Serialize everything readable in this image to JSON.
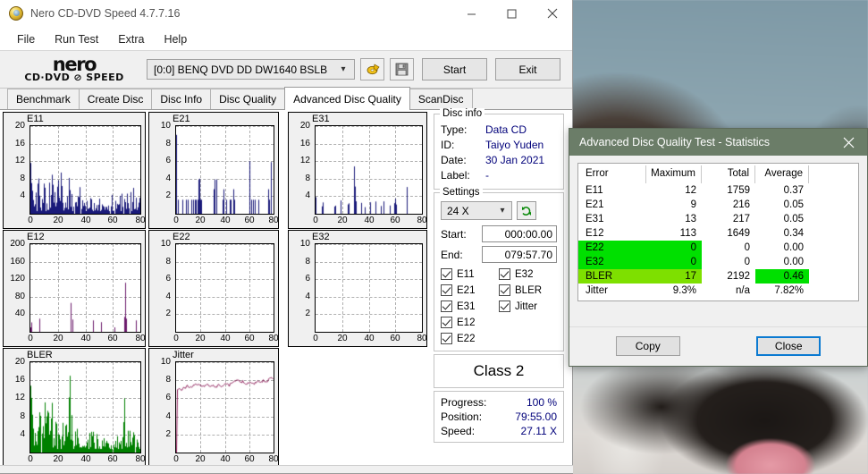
{
  "window": {
    "title": "Nero CD-DVD Speed 4.7.7.16",
    "icon": "nero-disc-icon",
    "minimize": "minimize-icon",
    "maximize": "maximize-icon",
    "close": "close-icon"
  },
  "menu": [
    "File",
    "Run Test",
    "Extra",
    "Help"
  ],
  "logo": {
    "word": "nero",
    "sub": "CD·DVD ⊘ SPEED"
  },
  "toolbar": {
    "drive": "[0:0]   BENQ DVD DD DW1640 BSLB",
    "eject_icon": "eject-disc-icon",
    "save_icon": "floppy-save-icon",
    "start_label": "Start",
    "exit_label": "Exit"
  },
  "tabs": [
    {
      "label": "Benchmark",
      "active": false
    },
    {
      "label": "Create Disc",
      "active": false
    },
    {
      "label": "Disc Info",
      "active": false
    },
    {
      "label": "Disc Quality",
      "active": false
    },
    {
      "label": "Advanced Disc Quality",
      "active": true
    },
    {
      "label": "ScanDisc",
      "active": false
    }
  ],
  "disc_info": {
    "legend": "Disc info",
    "rows": [
      {
        "key": "Type:",
        "value": "Data CD"
      },
      {
        "key": "ID:",
        "value": "Taiyo Yuden"
      },
      {
        "key": "Date:",
        "value": "30 Jan 2021"
      },
      {
        "key": "Label:",
        "value": "-"
      }
    ]
  },
  "settings": {
    "legend": "Settings",
    "speed": "24 X",
    "refresh_icon": "refresh-icon",
    "start_label": "Start:",
    "start_value": "000:00.00",
    "end_label": "End:",
    "end_value": "079:57.70",
    "checkboxes": [
      {
        "label": "E11",
        "checked": true
      },
      {
        "label": "E32",
        "checked": true
      },
      {
        "label": "E21",
        "checked": true
      },
      {
        "label": "BLER",
        "checked": true
      },
      {
        "label": "E31",
        "checked": true
      },
      {
        "label": "Jitter",
        "checked": true
      },
      {
        "label": "E12",
        "checked": true
      },
      {
        "label": "",
        "checked": null
      },
      {
        "label": "E22",
        "checked": true
      },
      {
        "label": "",
        "checked": null
      }
    ]
  },
  "quality_class": {
    "label": "Class 2",
    "color": "#7ef000"
  },
  "progress": {
    "rows": [
      {
        "key": "Progress:",
        "value": "100 %"
      },
      {
        "key": "Position:",
        "value": "79:55.00"
      },
      {
        "key": "Speed:",
        "value": "27.11 X"
      }
    ]
  },
  "stats_dialog": {
    "title": "Advanced Disc Quality Test - Statistics",
    "close_icon": "close-icon",
    "titlebar_color": "#6b7d68",
    "columns": [
      "Error",
      "Maximum",
      "Total",
      "Average"
    ],
    "rows": [
      {
        "error": "E11",
        "maximum": "12",
        "total": "1759",
        "average": "0.37",
        "highlight": "none"
      },
      {
        "error": "E21",
        "maximum": "9",
        "total": "216",
        "average": "0.05",
        "highlight": "none"
      },
      {
        "error": "E31",
        "maximum": "13",
        "total": "217",
        "average": "0.05",
        "highlight": "none"
      },
      {
        "error": "E12",
        "maximum": "113",
        "total": "1649",
        "average": "0.34",
        "highlight": "none"
      },
      {
        "error": "E22",
        "maximum": "0",
        "total": "0",
        "average": "0.00",
        "highlight": "green"
      },
      {
        "error": "E32",
        "maximum": "0",
        "total": "0",
        "average": "0.00",
        "highlight": "green"
      },
      {
        "error": "BLER",
        "maximum": "17",
        "total": "2192",
        "average": "0.46",
        "highlight": "lime-avg"
      },
      {
        "error": "Jitter",
        "maximum": "9.3%",
        "total": "n/a",
        "average": "7.82%",
        "highlight": "none"
      }
    ],
    "copy_label": "Copy",
    "close_label": "Close"
  },
  "chart_data": [
    {
      "type": "bar",
      "title": "E11",
      "color": "#1a1a7a",
      "xlabel": "",
      "ylabel": "",
      "xlim": [
        0,
        80
      ],
      "ylim": [
        0,
        20
      ],
      "xticks": [
        0,
        20,
        40,
        60,
        80
      ],
      "yticks": [
        4,
        8,
        12,
        16,
        20
      ],
      "grid": true,
      "seed": 11,
      "density": 0.9,
      "profile": "e11"
    },
    {
      "type": "bar",
      "title": "E21",
      "color": "#1a1a7a",
      "xlabel": "",
      "ylabel": "",
      "xlim": [
        0,
        80
      ],
      "ylim": [
        0,
        10
      ],
      "xticks": [
        0,
        20,
        40,
        60,
        80
      ],
      "yticks": [
        2,
        4,
        6,
        8,
        10
      ],
      "grid": true,
      "seed": 21,
      "density": 0.22,
      "profile": "sparse"
    },
    {
      "type": "bar",
      "title": "E31",
      "color": "#1a1a7a",
      "xlabel": "",
      "ylabel": "",
      "xlim": [
        0,
        80
      ],
      "ylim": [
        0,
        20
      ],
      "xticks": [
        0,
        20,
        40,
        60,
        80
      ],
      "yticks": [
        4,
        8,
        12,
        16,
        20
      ],
      "grid": true,
      "seed": 31,
      "density": 0.1,
      "profile": "spikes"
    },
    {
      "type": "bar",
      "title": "E12",
      "color": "#6b1a6b",
      "xlabel": "",
      "ylabel": "",
      "xlim": [
        0,
        80
      ],
      "ylim": [
        0,
        200
      ],
      "xticks": [
        0,
        20,
        40,
        60,
        80
      ],
      "yticks": [
        40,
        80,
        120,
        160,
        200
      ],
      "grid": true,
      "seed": 12,
      "density": 0.07,
      "profile": "bigspikes"
    },
    {
      "type": "bar",
      "title": "E22",
      "color": "#1a1a7a",
      "xlabel": "",
      "ylabel": "",
      "xlim": [
        0,
        80
      ],
      "ylim": [
        0,
        10
      ],
      "xticks": [
        0,
        20,
        40,
        60,
        80
      ],
      "yticks": [
        2,
        4,
        6,
        8,
        10
      ],
      "grid": true,
      "seed": 22,
      "density": 0.0,
      "profile": "empty"
    },
    {
      "type": "bar",
      "title": "E32",
      "color": "#1a1a7a",
      "xlabel": "",
      "ylabel": "",
      "xlim": [
        0,
        80
      ],
      "ylim": [
        0,
        10
      ],
      "xticks": [
        0,
        20,
        40,
        60,
        80
      ],
      "yticks": [
        2,
        4,
        6,
        8,
        10
      ],
      "grid": true,
      "seed": 32,
      "density": 0.0,
      "profile": "empty"
    },
    {
      "type": "bar",
      "title": "BLER",
      "color": "#008000",
      "xlabel": "",
      "ylabel": "",
      "xlim": [
        0,
        80
      ],
      "ylim": [
        0,
        20
      ],
      "xticks": [
        0,
        20,
        40,
        60,
        80
      ],
      "yticks": [
        4,
        8,
        12,
        16,
        20
      ],
      "grid": true,
      "seed": 99,
      "density": 0.95,
      "profile": "bler"
    },
    {
      "type": "line",
      "title": "Jitter",
      "color": "#8b1a56",
      "xlabel": "",
      "ylabel": "",
      "xlim": [
        0,
        80
      ],
      "ylim": [
        0,
        10
      ],
      "xticks": [
        0,
        20,
        40,
        60,
        80
      ],
      "yticks": [
        2,
        4,
        6,
        8,
        10
      ],
      "grid": true,
      "seed": 7,
      "density": 1.0,
      "profile": "jitter"
    }
  ]
}
